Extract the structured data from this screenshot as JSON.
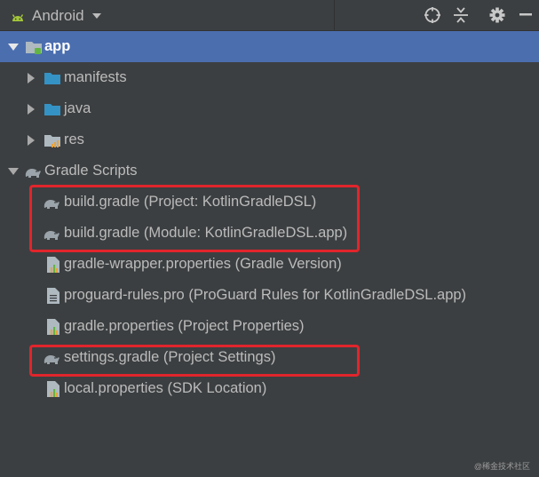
{
  "toolbar": {
    "view_label": "Android",
    "buttons": [
      "locate-icon",
      "collapse-all-icon",
      "settings-icon"
    ]
  },
  "tree": {
    "root": "app",
    "folders": [
      "manifests",
      "java",
      "res"
    ],
    "gradle_group": "Gradle Scripts",
    "files": [
      "build.gradle (Project: KotlinGradleDSL)",
      "build.gradle (Module: KotlinGradleDSL.app)",
      "gradle-wrapper.properties (Gradle Version)",
      "proguard-rules.pro (ProGuard Rules for KotlinGradleDSL.app)",
      "gradle.properties (Project Properties)",
      "settings.gradle (Project Settings)",
      "local.properties (SDK Location)"
    ]
  },
  "watermark": "@稀金技术社区",
  "colors": {
    "background": "#3c3f41",
    "selection": "#4b6eaf",
    "text": "#bbbbbb",
    "folder": "#3592c4",
    "android_green": "#a4c639",
    "highlight_box": "#e1252c"
  }
}
